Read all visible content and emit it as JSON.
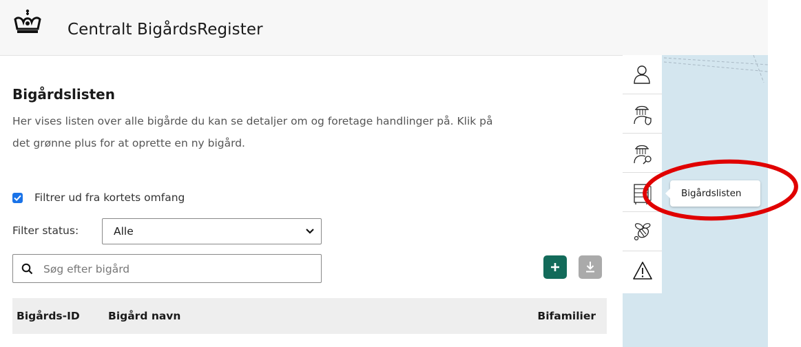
{
  "header": {
    "app_title": "Centralt BigårdsRegister",
    "logo_icon": "crown-icon"
  },
  "page": {
    "title": "Bigårdslisten",
    "description_line1": "Her vises listen over alle bigårde du kan se detaljer om og foretage handlinger på. Klik på",
    "description_line2": "det grønne plus for at oprette en ny bigård."
  },
  "filters": {
    "map_filter_label": "Filtrer ud fra kortets omfang",
    "map_filter_checked": true,
    "status_label": "Filter status:",
    "status_selected": "Alle"
  },
  "search": {
    "placeholder": "Søg efter bigård",
    "value": ""
  },
  "actions": {
    "add_icon": "plus-icon",
    "add_color": "#136b5a",
    "download_icon": "download-icon",
    "download_color": "#aaaaaa"
  },
  "table": {
    "columns": [
      "Bigårds-ID",
      "Bigård navn",
      "Bifamilier"
    ]
  },
  "toolbar": {
    "items": [
      {
        "icon": "user-icon"
      },
      {
        "icon": "beekeeper-shield-icon"
      },
      {
        "icon": "beekeeper-search-icon"
      },
      {
        "icon": "beehive-list-icon"
      },
      {
        "icon": "bee-icon"
      },
      {
        "icon": "warning-icon"
      }
    ],
    "tooltip": "Bigårdslisten"
  },
  "colors": {
    "checkbox": "#1a73e8",
    "map_background": "#d4e6ef",
    "highlight_circle": "#e00000"
  }
}
